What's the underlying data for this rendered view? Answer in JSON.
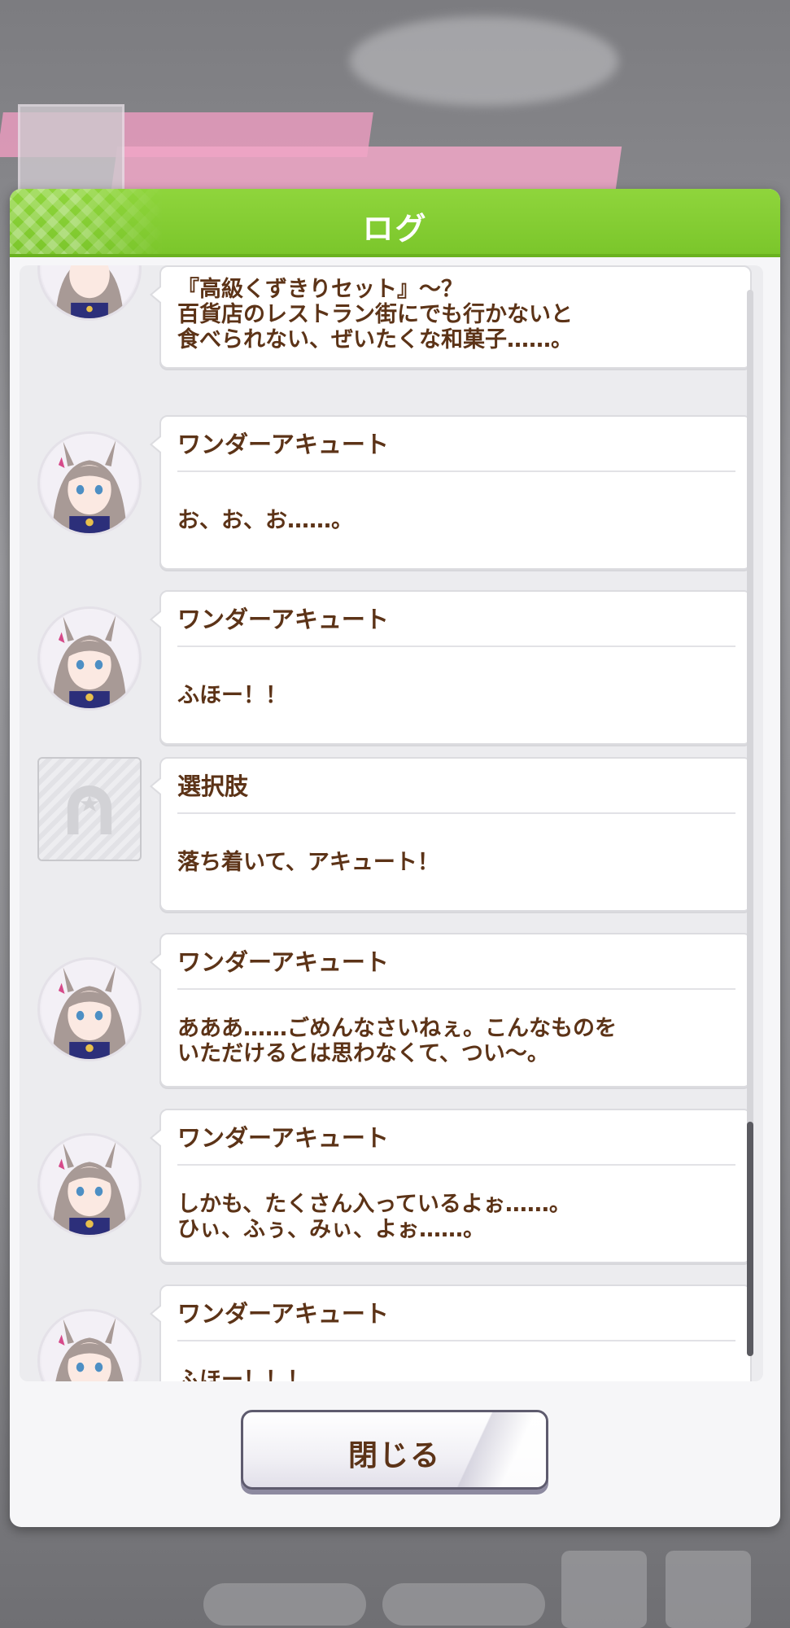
{
  "dialog": {
    "title": "ログ",
    "close_label": "閉じる"
  },
  "log": [
    {
      "type": "character",
      "speaker": "",
      "message": "『高級くずきりセット』～？\n百貨店のレストラン街にでも行かないと\n食べられない、ぜいたくな和菓子……。"
    },
    {
      "type": "character",
      "speaker": "ワンダーアキュート",
      "message": "お、お、お……。"
    },
    {
      "type": "character",
      "speaker": "ワンダーアキュート",
      "message": "ふほー！！"
    },
    {
      "type": "choice",
      "speaker": "選択肢",
      "message": "落ち着いて、アキュート！"
    },
    {
      "type": "character",
      "speaker": "ワンダーアキュート",
      "message": "あああ……ごめんなさいねぇ。こんなものを\nいただけるとは思わなくて、つい～。"
    },
    {
      "type": "character",
      "speaker": "ワンダーアキュート",
      "message": "しかも、たくさん入っているよぉ……。\nひぃ、ふぅ、みぃ、よぉ……。"
    },
    {
      "type": "character",
      "speaker": "ワンダーアキュート",
      "message": "ふほー！！！"
    }
  ],
  "colors": {
    "header_green": "#7bc62b",
    "text_brown": "#5c3317"
  },
  "icons": {
    "avatar": "character-portrait-icon",
    "choice": "horseshoe-icon"
  }
}
